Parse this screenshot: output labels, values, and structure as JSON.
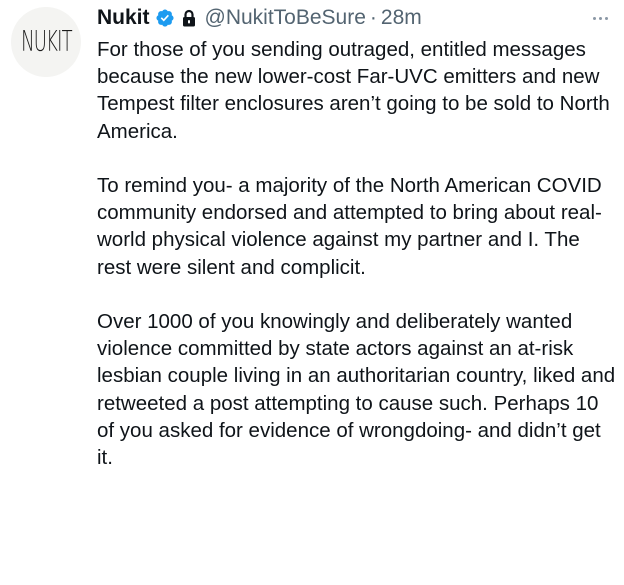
{
  "tweet": {
    "avatar_text": "NUKIT",
    "display_name": "Nukit",
    "handle": "@NukitToBeSure",
    "separator": "·",
    "timestamp": "28m",
    "icons": {
      "verified": "verified-badge-icon",
      "lock": "lock-icon",
      "more": "more-options-icon"
    },
    "colors": {
      "verified_blue": "#1d9bf0",
      "secondary_text": "#536471",
      "primary_text": "#0f1419"
    },
    "paragraphs": [
      "For those of you sending outraged, entitled messages because the new lower-cost Far-UVC emitters and new Tempest filter enclosures aren’t going to be sold to North America.",
      "To remind you- a majority of the North American COVID community endorsed and attempted to bring about real-world physical violence against my partner and I. The rest were silent and complicit.",
      "Over 1000 of you knowingly and deliberately wanted violence committed by state actors against an at-risk lesbian couple living in an authoritarian country, liked and retweeted a post attempting to cause such. Perhaps 10 of you asked for evidence of wrongdoing- and didn’t get it."
    ]
  }
}
